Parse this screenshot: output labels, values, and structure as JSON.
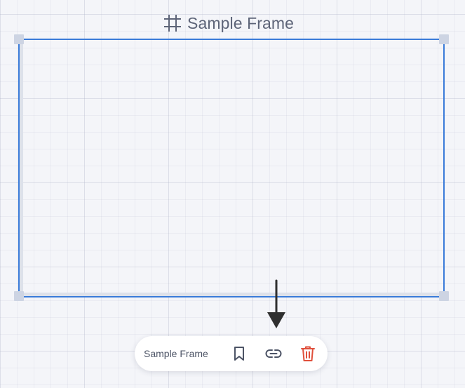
{
  "frame": {
    "title": "Sample Frame",
    "title_icon": "frame-hash-icon",
    "border_color": "#3a7bd9"
  },
  "toolbar": {
    "label": "Sample Frame",
    "buttons": [
      {
        "icon": "bookmark-icon",
        "color": "#4d5466"
      },
      {
        "icon": "link-icon",
        "color": "#4d5466"
      },
      {
        "icon": "trash-icon",
        "color": "#e0503c"
      }
    ]
  },
  "annotation": {
    "icon": "down-arrow-icon",
    "color": "#2f2f2f"
  }
}
